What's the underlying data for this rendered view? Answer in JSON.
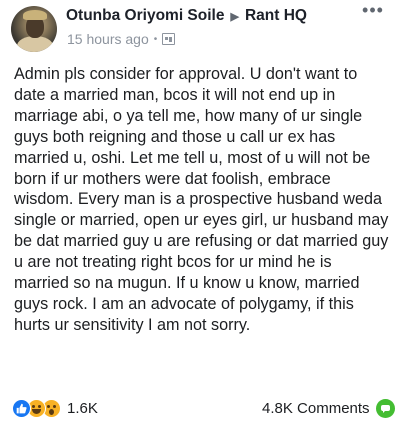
{
  "post": {
    "author": "Otunba Oriyomi Soile",
    "group": "Rant HQ",
    "time": "15 hours ago",
    "body": "Admin pls consider for approval. U don't want to date a married man, bcos it will not end up in marriage abi, o ya tell me, how many of ur single guys both reigning and those u call ur ex has married u, oshi. Let me tell u, most of u will not be born if ur mothers were dat foolish, embrace wisdom. Every man is a prospective husband weda single or married, open ur eyes girl, ur husband may be dat married guy u are refusing or dat married guy u are not treating right bcos for ur mind he is married so na mugun. If u know u know, married guys rock. I am an advocate of polygamy, if this hurts ur sensitivity I am not sorry."
  },
  "footer": {
    "reaction_count": "1.6K",
    "comments_label": "4.8K Comments"
  },
  "icons": {
    "privacy": "group-icon",
    "more": "more-options-icon",
    "reactions": [
      "like-reaction-icon",
      "haha-reaction-icon",
      "wow-reaction-icon"
    ],
    "comment": "comment-bubble-icon"
  },
  "colors": {
    "like": "#1877f2",
    "emoji": "#f7b125",
    "comment": "#44bd32",
    "meta": "#8d949e"
  }
}
